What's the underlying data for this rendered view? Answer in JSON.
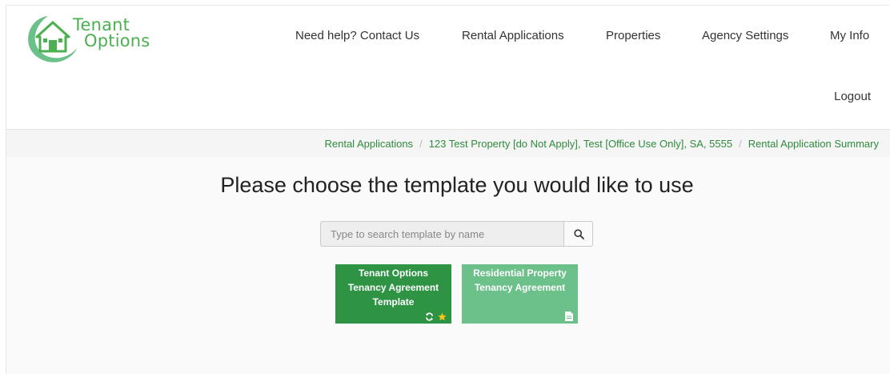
{
  "header": {
    "logo": {
      "line1": "Tenant",
      "line2": "Options"
    },
    "nav": [
      {
        "label": "Need help? Contact Us"
      },
      {
        "label": "Rental Applications"
      },
      {
        "label": "Properties"
      },
      {
        "label": "Agency Settings"
      },
      {
        "label": "My Info"
      }
    ],
    "logout": "Logout"
  },
  "breadcrumb": [
    {
      "label": "Rental Applications"
    },
    {
      "label": "123 Test Property [do Not Apply], Test [Office Use Only], SA, 5555"
    },
    {
      "label": "Rental Application Summary"
    }
  ],
  "main": {
    "title": "Please choose the template you would like to use",
    "search": {
      "placeholder": "Type to search template by name",
      "value": ""
    },
    "templates": [
      {
        "lines": [
          "Tenant Options",
          "Tenancy Agreement",
          "Template"
        ],
        "color": "#2e9444",
        "icons": [
          "refresh-icon",
          "star-icon"
        ]
      },
      {
        "lines": [
          "Residential Property",
          "Tenancy Agreement"
        ],
        "color": "#6cc08a",
        "icons": [
          "document-icon"
        ]
      }
    ]
  },
  "colors": {
    "brand": "#4caf50",
    "link": "#2e8b3d",
    "star": "#f5c518"
  }
}
